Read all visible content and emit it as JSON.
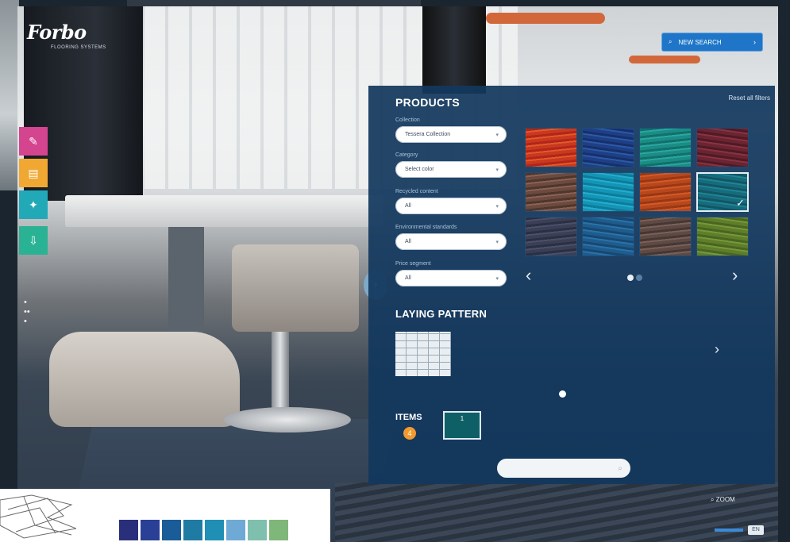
{
  "brand": {
    "name": "Forbo",
    "tagline": "FLOORING SYSTEMS"
  },
  "header": {
    "top_label": "",
    "search_button": "NEW SEARCH",
    "search_icon": "search-icon"
  },
  "tools": [
    {
      "name": "brush-tool",
      "icon": "brush-icon",
      "color": "#d5448f"
    },
    {
      "name": "layers-tool",
      "icon": "layers-icon",
      "color": "#f0a833"
    },
    {
      "name": "pattern-tool",
      "icon": "grid-icon",
      "color": "#22a9b8"
    },
    {
      "name": "download-tool",
      "icon": "download-icon",
      "color": "#2ab294"
    }
  ],
  "panel": {
    "title": "PRODUCTS",
    "reset_label": "Reset all filters",
    "filters": [
      {
        "label": "Collection",
        "value": "Tessera Collection"
      },
      {
        "label": "Category",
        "value": "Select color"
      },
      {
        "label": "Recycled content",
        "value": "All"
      },
      {
        "label": "Environmental standards",
        "value": "All"
      },
      {
        "label": "Price segment",
        "value": "All"
      }
    ],
    "swatches": [
      {
        "colors": [
          "#c9381f",
          "#e15a2a",
          "#b1251a"
        ],
        "selected": false
      },
      {
        "colors": [
          "#1f3f85",
          "#2a5aa8",
          "#17306a"
        ],
        "selected": false
      },
      {
        "colors": [
          "#1b8c86",
          "#2aa7a0",
          "#127069"
        ],
        "selected": false
      },
      {
        "colors": [
          "#6a2432",
          "#8a3241",
          "#4e1a25"
        ],
        "selected": false
      },
      {
        "colors": [
          "#6b4a3f",
          "#8a6252",
          "#4f362d"
        ],
        "selected": false
      },
      {
        "colors": [
          "#1495b5",
          "#24add0",
          "#0d7c98"
        ],
        "selected": false
      },
      {
        "colors": [
          "#b8471d",
          "#d45a26",
          "#983814"
        ],
        "selected": false
      },
      {
        "colors": [
          "#176b7c",
          "#1e8495",
          "#115664"
        ],
        "selected": true
      },
      {
        "colors": [
          "#3a3f55",
          "#4a506b",
          "#2b2f42"
        ],
        "selected": false
      },
      {
        "colors": [
          "#1f5c8c",
          "#2a72aa",
          "#174872"
        ],
        "selected": false
      },
      {
        "colors": [
          "#5e4a44",
          "#7a6058",
          "#463733"
        ],
        "selected": false
      },
      {
        "colors": [
          "#5e7e2b",
          "#76983a",
          "#4a6520"
        ],
        "selected": false
      }
    ],
    "carousel": {
      "pages": 2,
      "current": 1
    },
    "laying_pattern_title": "LAYING PATTERN",
    "items_label": "ITEMS",
    "items_count": "4",
    "item_tile_label": "1",
    "bottom_field_placeholder": ""
  },
  "footer": {
    "zoom_label": "ZOOM",
    "lang_label": "EN"
  },
  "palette": [
    "#2a2f7c",
    "#2a3f96",
    "#1a5c98",
    "#1f7ba3",
    "#1f8fb5",
    "#6fa9d6",
    "#7fbfae",
    "#7fb67a"
  ]
}
